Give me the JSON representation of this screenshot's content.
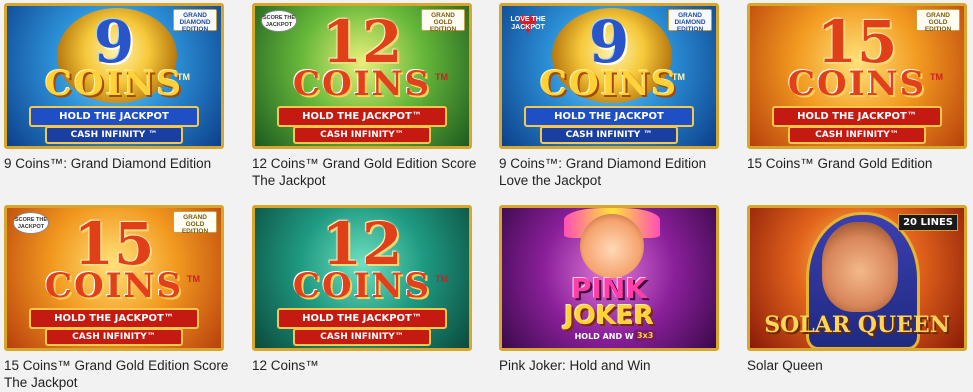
{
  "games": [
    {
      "title": "9 Coins™: Grand Diamond Edition",
      "art": {
        "number": "9",
        "word": "COINS",
        "tm": "TM",
        "line1": "HOLD THE JACKPOT",
        "line2": "CASH INFINITY ™",
        "badge": "GRAND DIAMOND EDITION"
      }
    },
    {
      "title": "12 Coins™ Grand Gold Edition Score The Jackpot",
      "art": {
        "number": "12",
        "word": "COINS",
        "tm": "TM",
        "line1": "HOLD THE JACKPOT™",
        "line2": "CASH INFINITY™",
        "badge": "GRAND GOLD EDITION",
        "stamp": "SCORE THE JACKPOT"
      }
    },
    {
      "title": "9 Coins™: Grand Diamond Edition Love the Jackpot",
      "art": {
        "number": "9",
        "word": "COINS",
        "tm": "TM",
        "line1": "HOLD THE JACKPOT",
        "line2": "CASH INFINITY ™",
        "badge": "GRAND DIAMOND EDITION",
        "stamp": "LOVE THE JACKPOT"
      }
    },
    {
      "title": "15 Coins™ Grand Gold Edition",
      "art": {
        "number": "15",
        "word": "COINS",
        "tm": "TM",
        "line1": "HOLD THE JACKPOT™",
        "line2": "CASH INFINITY™",
        "badge": "GRAND GOLD EDITION"
      }
    },
    {
      "title": "15 Coins™ Grand Gold Edition Score The Jackpot",
      "art": {
        "number": "15",
        "word": "COINS",
        "tm": "TM",
        "line1": "HOLD THE JACKPOT™",
        "line2": "CASH INFINITY™",
        "badge": "GRAND GOLD EDITION",
        "stamp": "SCORE THE JACKPOT"
      }
    },
    {
      "title": "12 Coins™",
      "art": {
        "number": "12",
        "word": "COINS",
        "tm": "TM",
        "line1": "HOLD THE JACKPOT™",
        "line2": "CASH INFINITY™"
      }
    },
    {
      "title": "Pink Joker: Hold and Win",
      "art": {
        "word1": "PINK",
        "word2": "JOKER",
        "line1": "HOLD AND WIN",
        "badge": "3x3"
      }
    },
    {
      "title": "Solar Queen",
      "art": {
        "word": "SOLAR QUEEN",
        "badge": "20 LINES"
      }
    }
  ]
}
